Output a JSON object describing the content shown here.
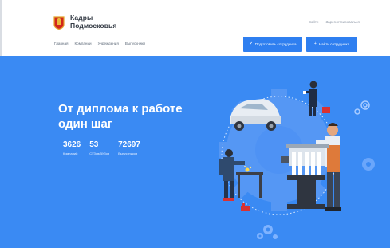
{
  "brand": {
    "name_line1": "Кадры",
    "name_line2": "Подмосковья",
    "logo_icon": "moscow-region-coat-of-arms"
  },
  "auth": {
    "login": "Войти",
    "register": "Зарегистрироваться"
  },
  "nav": {
    "items": [
      "Главная",
      "Компании",
      "Учреждения",
      "Выпускники"
    ]
  },
  "actions": {
    "prepare_label": "Подготовить сотрудника",
    "prepare_icon": "check-icon",
    "find_label": "Найти сотрудника",
    "find_icon": "plus-icon"
  },
  "hero": {
    "title_line1": "От диплома к работе",
    "title_line2": "один шаг",
    "stats": [
      {
        "value": "3626",
        "label": "Компаний"
      },
      {
        "value": "53",
        "label": "СУЗов/ВУЗов"
      },
      {
        "value": "72697",
        "label": "Выпускников"
      }
    ]
  },
  "colors": {
    "hero_bg": "#3a8af3",
    "button_bg": "#2f7ff0",
    "gear": "#5f9cf6"
  }
}
